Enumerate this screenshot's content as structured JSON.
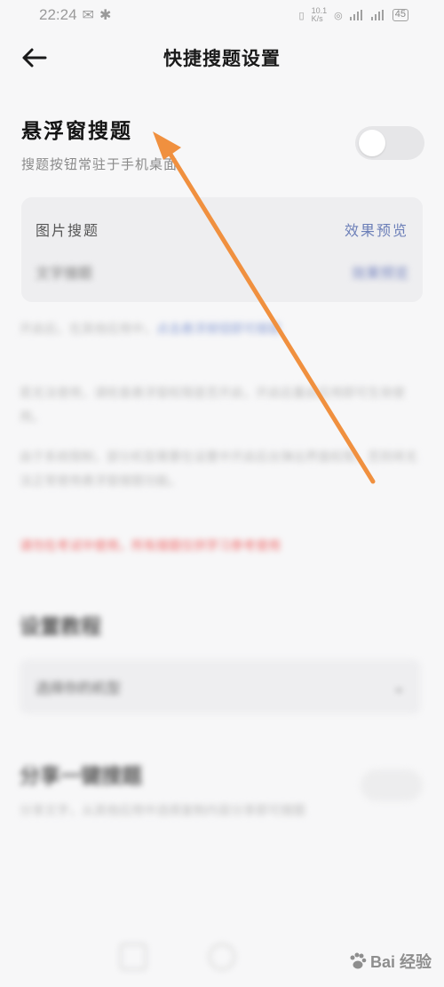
{
  "status_bar": {
    "time": "22:24",
    "speed": "10.1\nK/s",
    "battery": "45"
  },
  "header": {
    "title": "快捷搜题设置"
  },
  "floating": {
    "title": "悬浮窗搜题",
    "description": "搜题按钮常驻于手机桌面",
    "enabled": false
  },
  "card": {
    "row1_label": "图片搜题",
    "row1_link": "效果预览",
    "row2_label": "文字搜题",
    "row2_link": "效果预览"
  },
  "paragraphs": {
    "p1": "开启后，在其他应用中，",
    "p1_link": "点击悬浮按钮即可搜题",
    "p2": "若无法使用，请检查悬浮窗权限是否开启，开启后重启应用即可生效使用。",
    "p3": "由于系统限制，部分机型需要在设置中开启后台弹出界面权限，否则将无法正常使用悬浮窗搜题功能。",
    "p4_red": "请勿在考试中使用，所有搜题仅供学习参考使用"
  },
  "section1": {
    "title": "设置教程",
    "select_value": "选择你的机型"
  },
  "section2": {
    "title": "分享一键搜题",
    "desc": "分享文字，从其他应用中选择复制内容分享即可搜题"
  },
  "watermark": {
    "text": "Bai 经验"
  },
  "colors": {
    "accent_arrow": "#f0903f",
    "link": "#6c7fb8",
    "warning": "#f06b6b"
  }
}
